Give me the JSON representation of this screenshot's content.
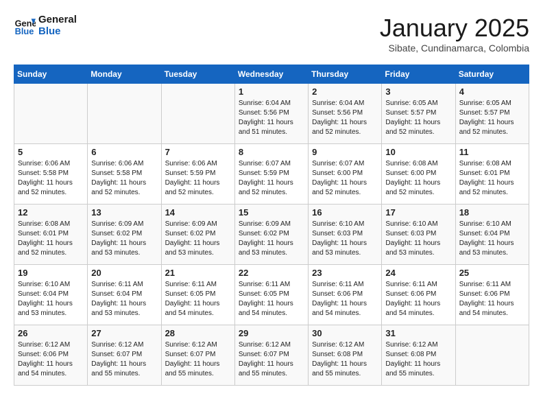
{
  "header": {
    "logo": {
      "line1": "General",
      "line2": "Blue"
    },
    "title": "January 2025",
    "subtitle": "Sibate, Cundinamarca, Colombia"
  },
  "days_of_week": [
    "Sunday",
    "Monday",
    "Tuesday",
    "Wednesday",
    "Thursday",
    "Friday",
    "Saturday"
  ],
  "weeks": [
    [
      {
        "day": "",
        "info": ""
      },
      {
        "day": "",
        "info": ""
      },
      {
        "day": "",
        "info": ""
      },
      {
        "day": "1",
        "info": "Sunrise: 6:04 AM\nSunset: 5:56 PM\nDaylight: 11 hours\nand 51 minutes."
      },
      {
        "day": "2",
        "info": "Sunrise: 6:04 AM\nSunset: 5:56 PM\nDaylight: 11 hours\nand 52 minutes."
      },
      {
        "day": "3",
        "info": "Sunrise: 6:05 AM\nSunset: 5:57 PM\nDaylight: 11 hours\nand 52 minutes."
      },
      {
        "day": "4",
        "info": "Sunrise: 6:05 AM\nSunset: 5:57 PM\nDaylight: 11 hours\nand 52 minutes."
      }
    ],
    [
      {
        "day": "5",
        "info": "Sunrise: 6:06 AM\nSunset: 5:58 PM\nDaylight: 11 hours\nand 52 minutes."
      },
      {
        "day": "6",
        "info": "Sunrise: 6:06 AM\nSunset: 5:58 PM\nDaylight: 11 hours\nand 52 minutes."
      },
      {
        "day": "7",
        "info": "Sunrise: 6:06 AM\nSunset: 5:59 PM\nDaylight: 11 hours\nand 52 minutes."
      },
      {
        "day": "8",
        "info": "Sunrise: 6:07 AM\nSunset: 5:59 PM\nDaylight: 11 hours\nand 52 minutes."
      },
      {
        "day": "9",
        "info": "Sunrise: 6:07 AM\nSunset: 6:00 PM\nDaylight: 11 hours\nand 52 minutes."
      },
      {
        "day": "10",
        "info": "Sunrise: 6:08 AM\nSunset: 6:00 PM\nDaylight: 11 hours\nand 52 minutes."
      },
      {
        "day": "11",
        "info": "Sunrise: 6:08 AM\nSunset: 6:01 PM\nDaylight: 11 hours\nand 52 minutes."
      }
    ],
    [
      {
        "day": "12",
        "info": "Sunrise: 6:08 AM\nSunset: 6:01 PM\nDaylight: 11 hours\nand 52 minutes."
      },
      {
        "day": "13",
        "info": "Sunrise: 6:09 AM\nSunset: 6:02 PM\nDaylight: 11 hours\nand 53 minutes."
      },
      {
        "day": "14",
        "info": "Sunrise: 6:09 AM\nSunset: 6:02 PM\nDaylight: 11 hours\nand 53 minutes."
      },
      {
        "day": "15",
        "info": "Sunrise: 6:09 AM\nSunset: 6:02 PM\nDaylight: 11 hours\nand 53 minutes."
      },
      {
        "day": "16",
        "info": "Sunrise: 6:10 AM\nSunset: 6:03 PM\nDaylight: 11 hours\nand 53 minutes."
      },
      {
        "day": "17",
        "info": "Sunrise: 6:10 AM\nSunset: 6:03 PM\nDaylight: 11 hours\nand 53 minutes."
      },
      {
        "day": "18",
        "info": "Sunrise: 6:10 AM\nSunset: 6:04 PM\nDaylight: 11 hours\nand 53 minutes."
      }
    ],
    [
      {
        "day": "19",
        "info": "Sunrise: 6:10 AM\nSunset: 6:04 PM\nDaylight: 11 hours\nand 53 minutes."
      },
      {
        "day": "20",
        "info": "Sunrise: 6:11 AM\nSunset: 6:04 PM\nDaylight: 11 hours\nand 53 minutes."
      },
      {
        "day": "21",
        "info": "Sunrise: 6:11 AM\nSunset: 6:05 PM\nDaylight: 11 hours\nand 54 minutes."
      },
      {
        "day": "22",
        "info": "Sunrise: 6:11 AM\nSunset: 6:05 PM\nDaylight: 11 hours\nand 54 minutes."
      },
      {
        "day": "23",
        "info": "Sunrise: 6:11 AM\nSunset: 6:06 PM\nDaylight: 11 hours\nand 54 minutes."
      },
      {
        "day": "24",
        "info": "Sunrise: 6:11 AM\nSunset: 6:06 PM\nDaylight: 11 hours\nand 54 minutes."
      },
      {
        "day": "25",
        "info": "Sunrise: 6:11 AM\nSunset: 6:06 PM\nDaylight: 11 hours\nand 54 minutes."
      }
    ],
    [
      {
        "day": "26",
        "info": "Sunrise: 6:12 AM\nSunset: 6:06 PM\nDaylight: 11 hours\nand 54 minutes."
      },
      {
        "day": "27",
        "info": "Sunrise: 6:12 AM\nSunset: 6:07 PM\nDaylight: 11 hours\nand 55 minutes."
      },
      {
        "day": "28",
        "info": "Sunrise: 6:12 AM\nSunset: 6:07 PM\nDaylight: 11 hours\nand 55 minutes."
      },
      {
        "day": "29",
        "info": "Sunrise: 6:12 AM\nSunset: 6:07 PM\nDaylight: 11 hours\nand 55 minutes."
      },
      {
        "day": "30",
        "info": "Sunrise: 6:12 AM\nSunset: 6:08 PM\nDaylight: 11 hours\nand 55 minutes."
      },
      {
        "day": "31",
        "info": "Sunrise: 6:12 AM\nSunset: 6:08 PM\nDaylight: 11 hours\nand 55 minutes."
      },
      {
        "day": "",
        "info": ""
      }
    ]
  ]
}
